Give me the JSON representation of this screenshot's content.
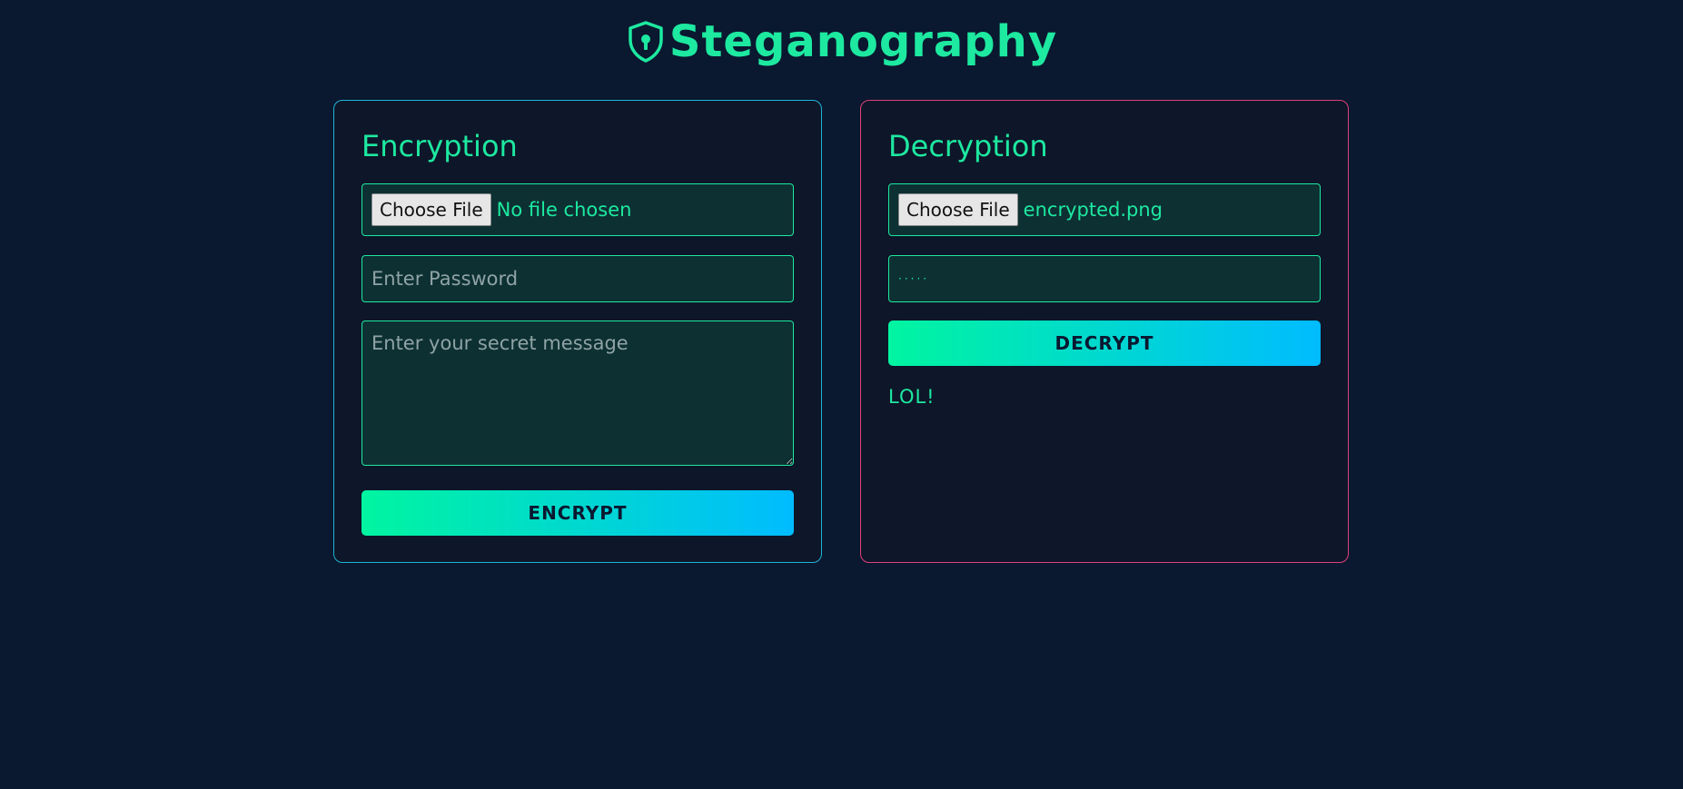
{
  "header": {
    "title": "Steganography",
    "icon": "shield-keyhole-icon",
    "accent_color": "#1de9a0"
  },
  "encryption": {
    "title": "Encryption",
    "file_button_label": "Choose File",
    "file_status": "No file chosen",
    "password_placeholder": "Enter Password",
    "password_value": "",
    "message_placeholder": "Enter your secret message",
    "message_value": "",
    "action_label": "ENCRYPT",
    "border_color": "#1fb5d3"
  },
  "decryption": {
    "title": "Decryption",
    "file_button_label": "Choose File",
    "file_status": "encrypted.png",
    "password_value": "·····",
    "action_label": "DECRYPT",
    "result_text": "LOL!",
    "border_color": "#e0407a"
  },
  "colors": {
    "background": "#0a1830",
    "button_gradient_start": "#00f5a0",
    "button_gradient_end": "#00bcff"
  }
}
